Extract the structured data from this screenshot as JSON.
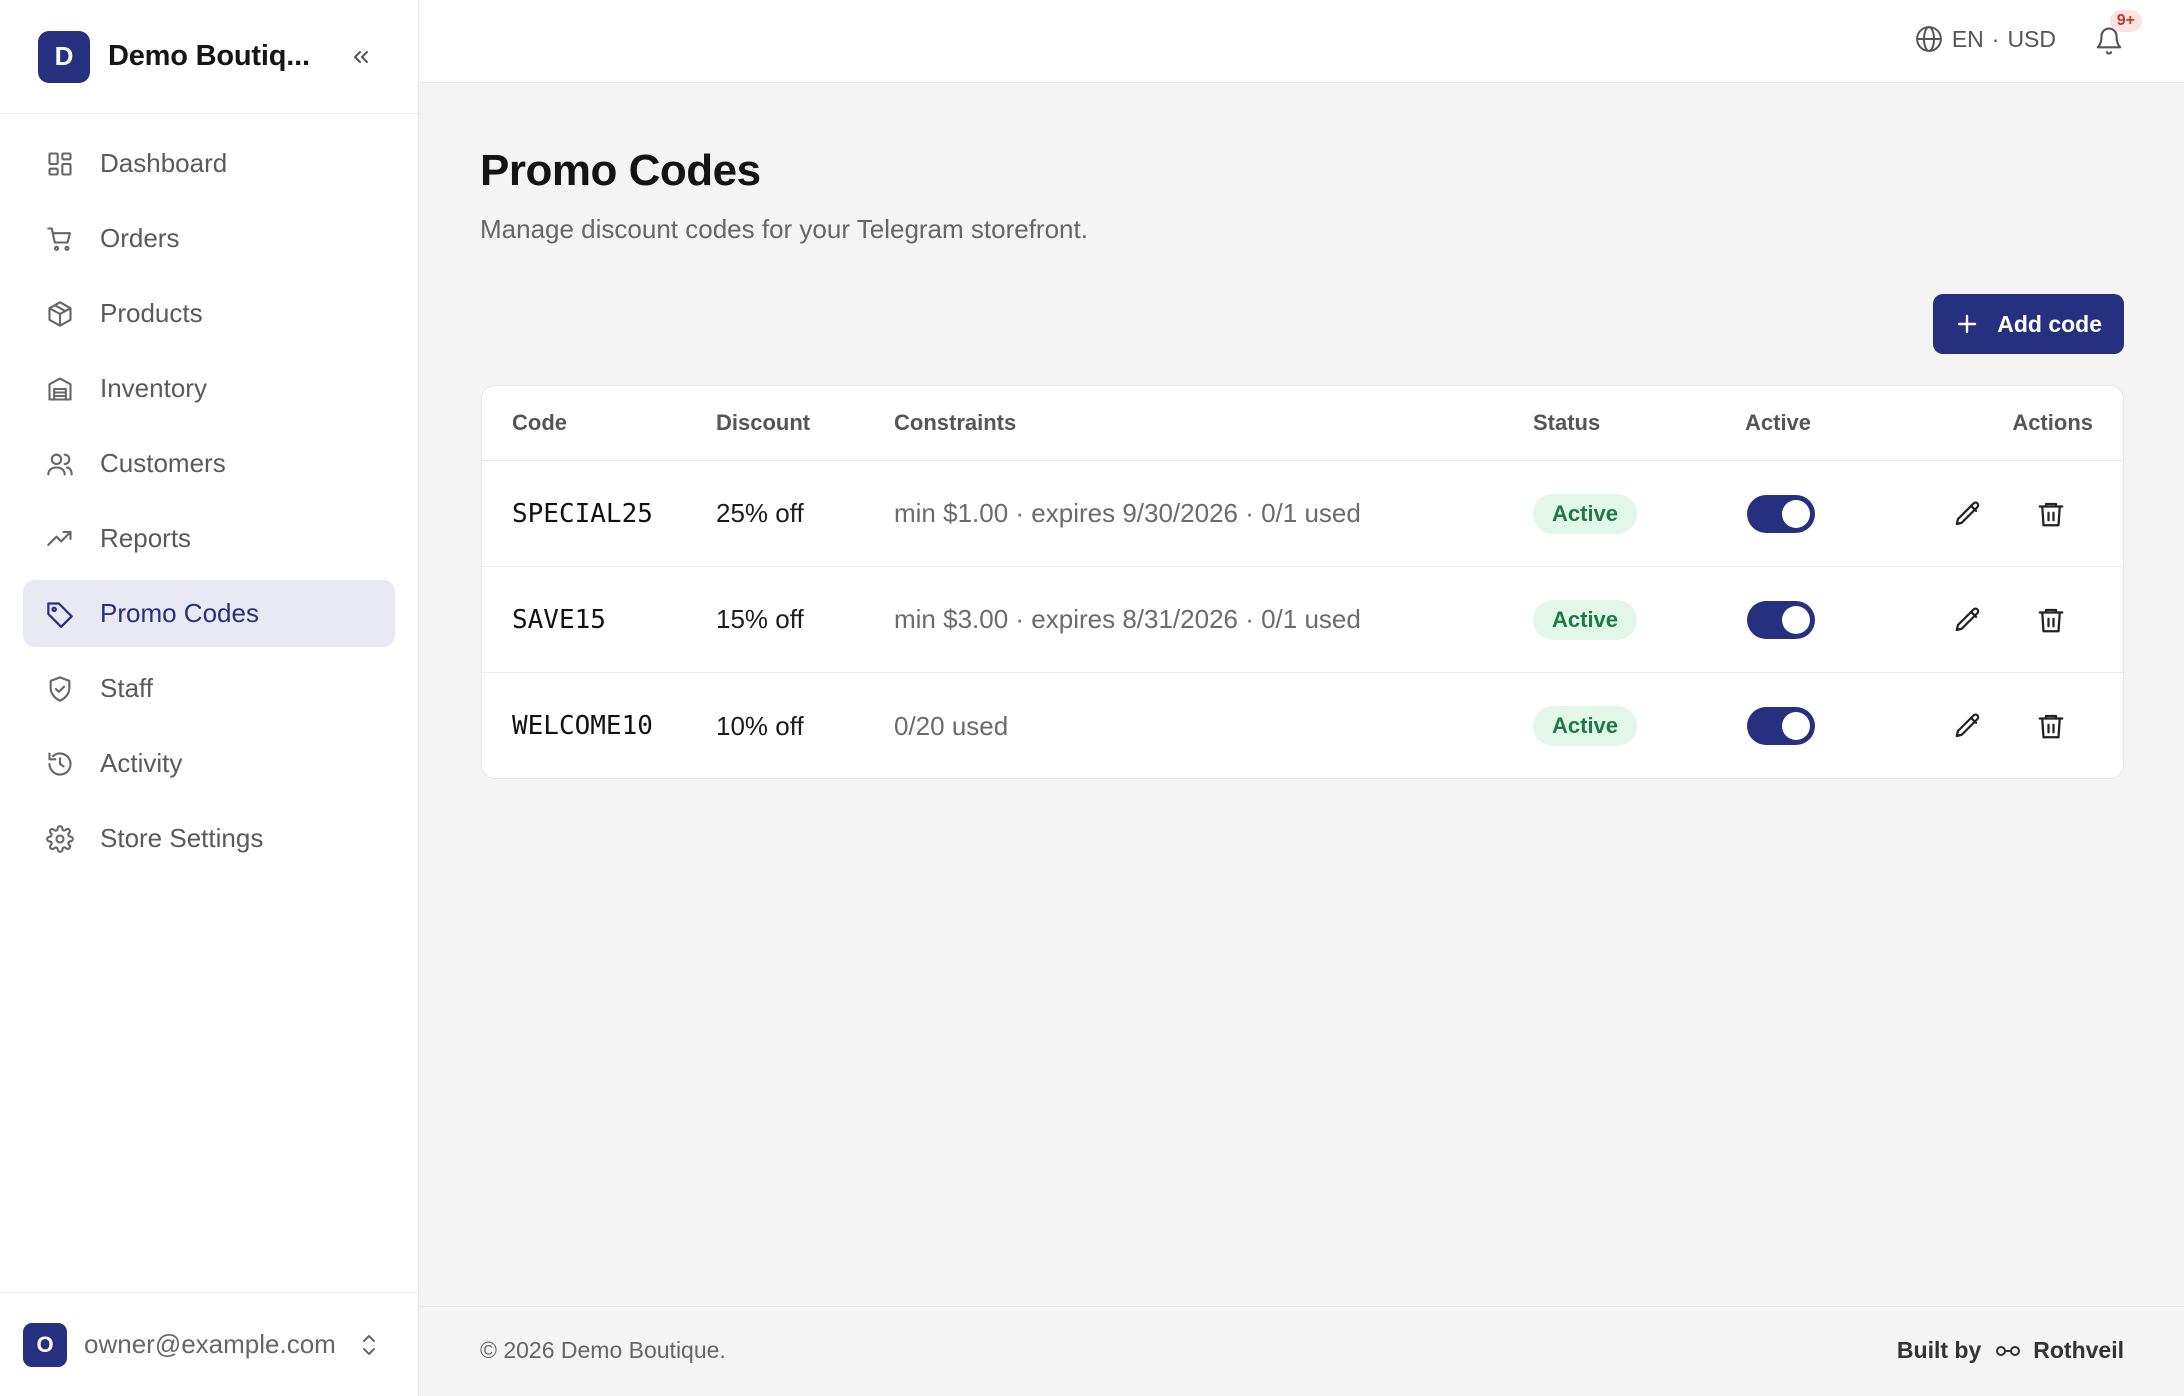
{
  "brand": {
    "initial": "D",
    "name": "Demo Boutiq..."
  },
  "sidebar": {
    "items": [
      {
        "label": "Dashboard",
        "icon": "dashboard-icon"
      },
      {
        "label": "Orders",
        "icon": "cart-icon"
      },
      {
        "label": "Products",
        "icon": "box-icon"
      },
      {
        "label": "Inventory",
        "icon": "warehouse-icon"
      },
      {
        "label": "Customers",
        "icon": "users-icon"
      },
      {
        "label": "Reports",
        "icon": "trend-icon"
      },
      {
        "label": "Promo Codes",
        "icon": "tag-icon",
        "active": true
      },
      {
        "label": "Staff",
        "icon": "shield-icon"
      },
      {
        "label": "Activity",
        "icon": "history-icon"
      },
      {
        "label": "Store Settings",
        "icon": "gear-icon"
      }
    ],
    "user": {
      "initial": "O",
      "email": "owner@example.com"
    }
  },
  "topbar": {
    "language": "EN",
    "separator": "·",
    "currency": "USD",
    "notification_badge": "9+"
  },
  "page": {
    "title": "Promo Codes",
    "subtitle": "Manage discount codes for your Telegram storefront.",
    "add_button": "Add code"
  },
  "table": {
    "columns": {
      "code": "Code",
      "discount": "Discount",
      "constraints": "Constraints",
      "status": "Status",
      "active": "Active",
      "actions": "Actions"
    },
    "rows": [
      {
        "code": "SPECIAL25",
        "discount": "25% off",
        "constraints": "min $1.00 · expires 9/30/2026 · 0/1 used",
        "status": "Active",
        "active": true
      },
      {
        "code": "SAVE15",
        "discount": "15% off",
        "constraints": "min $3.00 · expires 8/31/2026 · 0/1 used",
        "status": "Active",
        "active": true
      },
      {
        "code": "WELCOME10",
        "discount": "10% off",
        "constraints": "0/20 used",
        "status": "Active",
        "active": true
      }
    ]
  },
  "footer": {
    "copyright": "© 2026 Demo Boutique.",
    "built_by_label": "Built by",
    "built_by_name": "Rothveil"
  },
  "colors": {
    "accent": "#27307f",
    "active_nav_bg": "#e8e9f3",
    "status_bg": "#e3f6ea",
    "status_text": "#1e7a44",
    "badge_bg": "#fde2e2",
    "badge_text": "#c0392b"
  }
}
